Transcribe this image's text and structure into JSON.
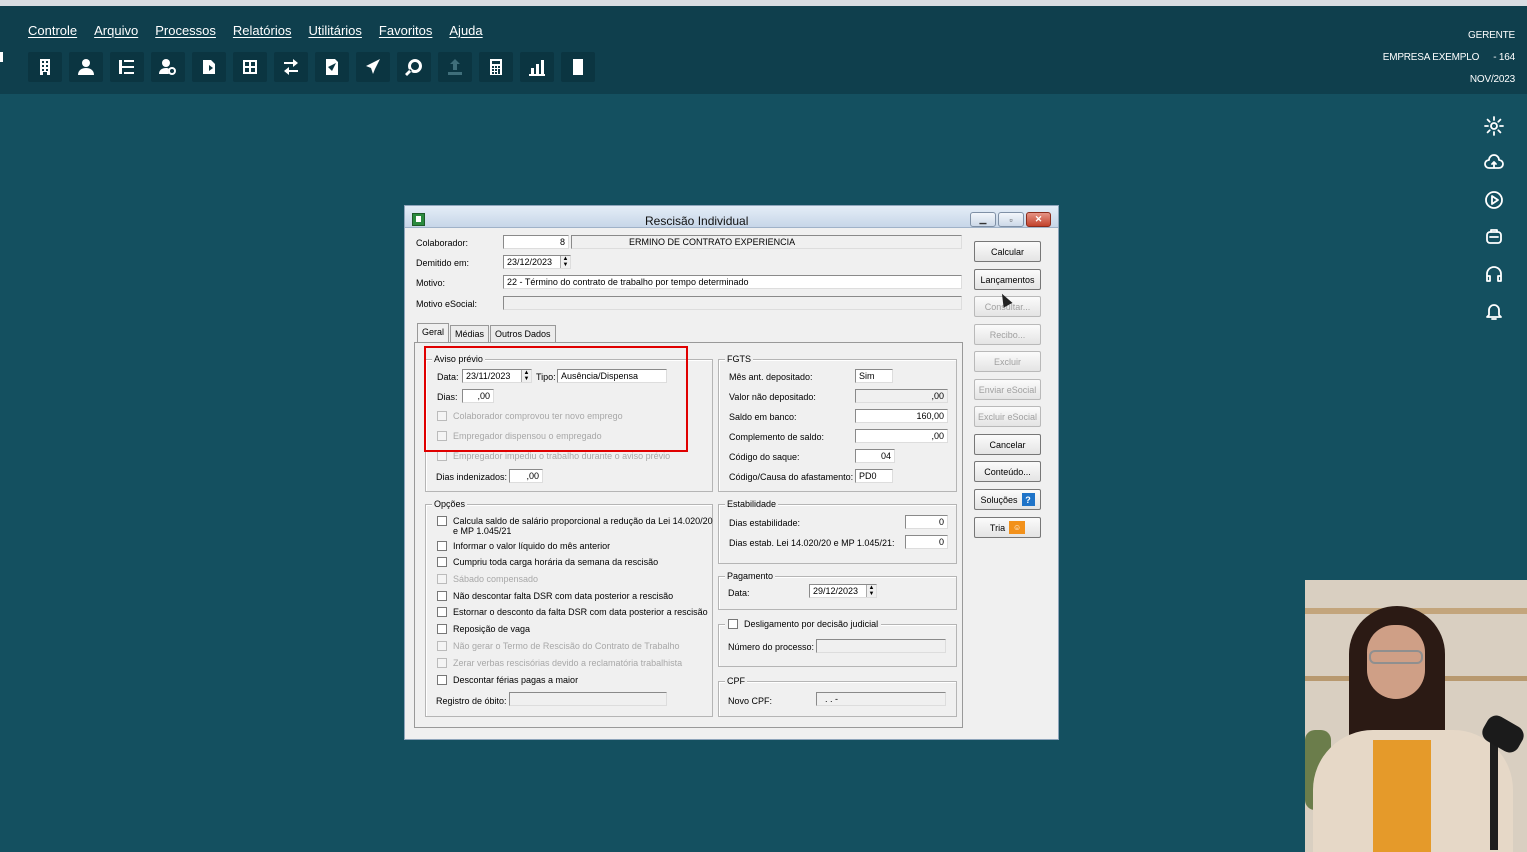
{
  "menu": [
    "Controle",
    "Arquivo",
    "Processos",
    "Relatórios",
    "Utilitários",
    "Favoritos",
    "Ajuda"
  ],
  "user": {
    "role": "GERENTE",
    "company": "EMPRESA EXEMPLO",
    "company_code": "- 164",
    "period": "NOV/2023"
  },
  "toolbar_icons": [
    "building-icon",
    "user-icon",
    "list-icon",
    "user-search-icon",
    "document-export-icon",
    "calculator-grid-icon",
    "transfer-icon",
    "document-icon",
    "airplane-icon",
    "search-icon",
    "upload-icon",
    "calculator-icon",
    "chart-icon",
    "book-icon"
  ],
  "side_icons": [
    "gear-icon",
    "cloud-upload-icon",
    "play-icon",
    "support-icon",
    "headset-icon",
    "bell-icon"
  ],
  "dialog": {
    "title": "Rescisão Individual",
    "colaborador_label": "Colaborador:",
    "colaborador_code": "8",
    "colaborador_name": "ERMINO DE CONTRATO EXPERIENCIA",
    "demitido_label": "Demitido em:",
    "demitido_value": "23/12/2023",
    "motivo_label": "Motivo:",
    "motivo_value": "22 - Término do contrato de trabalho por tempo determinado",
    "motivo_esocial_label": "Motivo eSocial:",
    "tabs": [
      "Geral",
      "Médias",
      "Outros Dados"
    ],
    "aviso": {
      "title": "Aviso prévio",
      "data_label": "Data:",
      "data_value": "23/11/2023",
      "tipo_label": "Tipo:",
      "tipo_value": "Ausência/Dispensa",
      "dias_label": "Dias:",
      "dias_value": ",00",
      "chk1": "Colaborador comprovou ter novo emprego",
      "chk2": "Empregador dispensou o empregado",
      "chk3": "Empregador impediu o trabalho durante o aviso prévio",
      "dias_indenizados_label": "Dias indenizados:",
      "dias_indenizados_value": ",00"
    },
    "fgts": {
      "title": "FGTS",
      "mes_ant_label": "Mês ant. depositado:",
      "mes_ant_value": "Sim",
      "valor_nao_label": "Valor não depositado:",
      "valor_nao_value": ",00",
      "saldo_label": "Saldo em banco:",
      "saldo_value": "160,00",
      "complemento_label": "Complemento de saldo:",
      "complemento_value": ",00",
      "codigo_saque_label": "Código do saque:",
      "codigo_saque_value": "04",
      "codigo_causa_label": "Código/Causa do afastamento:",
      "codigo_causa_value": "PD0"
    },
    "opcoes": {
      "title": "Opções",
      "items": [
        {
          "label": "Calcula saldo de salário proporcional a redução da Lei 14.020/20",
          "label2": "e MP 1.045/21"
        },
        {
          "label": "Informar o valor líquido do mês anterior"
        },
        {
          "label": "Cumpriu toda carga horária da semana da rescisão"
        },
        {
          "label": "Sábado compensado"
        },
        {
          "label": "Não descontar falta DSR com data posterior a rescisão"
        },
        {
          "label": "Estornar o desconto da falta DSR com data posterior a rescisão"
        },
        {
          "label": "Reposição de vaga"
        },
        {
          "label": "Não gerar o Termo de Rescisão do Contrato de Trabalho"
        },
        {
          "label": "Zerar verbas rescisórias devido a reclamatória trabalhista"
        },
        {
          "label": "Descontar férias pagas a maior"
        }
      ],
      "registro_obito_label": "Registro de óbito:"
    },
    "estabilidade": {
      "title": "Estabilidade",
      "dias_label": "Dias estabilidade:",
      "dias_value": "0",
      "dias_lei_label": "Dias estab. Lei 14.020/20 e MP 1.045/21:",
      "dias_lei_value": "0"
    },
    "pagamento": {
      "title": "Pagamento",
      "data_label": "Data:",
      "data_value": "29/12/2023"
    },
    "desligamento": {
      "label": "Desligamento por decisão judicial",
      "numero_label": "Número do processo:"
    },
    "cpf": {
      "title": "CPF",
      "novo_label": "Novo CPF:",
      "novo_value": ". . -"
    },
    "buttons": {
      "calcular": "Calcular",
      "lancamentos": "Lançamentos",
      "consultar": "Consultar...",
      "recibo": "Recibo...",
      "excluir": "Excluir",
      "enviar_esocial": "Enviar eSocial",
      "excluir_esocial": "Excluir eSocial",
      "cancelar": "Cancelar",
      "conteudo": "Conteúdo...",
      "solucoes": "Soluções",
      "tria": "Tria"
    }
  }
}
